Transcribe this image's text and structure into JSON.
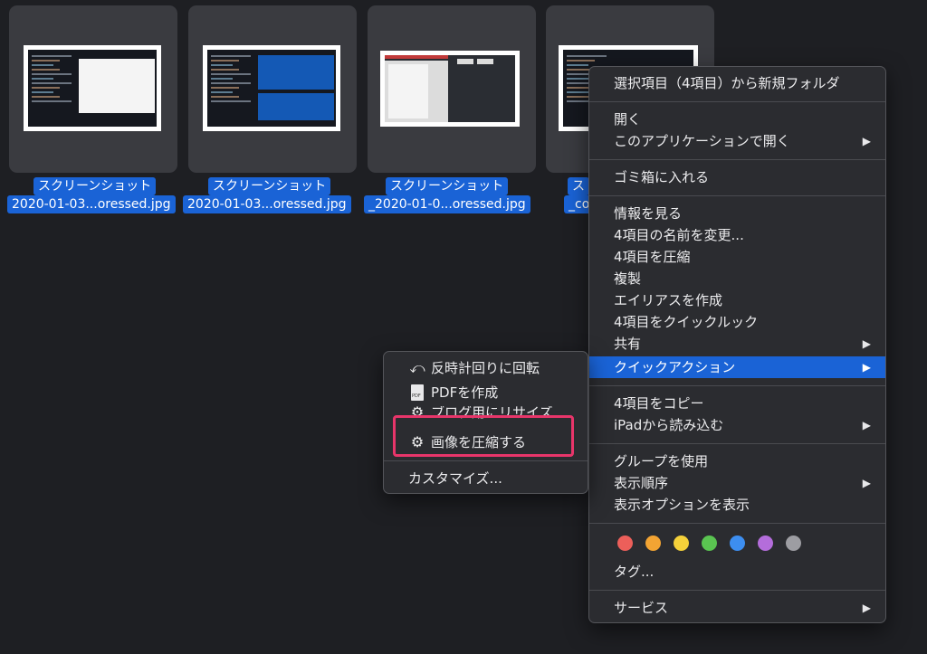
{
  "files": [
    {
      "label_line1": "スクリーンショット",
      "label_line2": "2020-01-03...oressed.jpg"
    },
    {
      "label_line1": "スクリーンショット",
      "label_line2": "2020-01-03...oressed.jpg"
    },
    {
      "label_line1": "スクリーンショット",
      "label_line2": "_2020-01-0...oressed.jpg"
    },
    {
      "label_line1": "ス",
      "label_line2": "_co"
    }
  ],
  "context_menu": {
    "new_folder": "選択項目（4項目）から新規フォルダ",
    "open": "開く",
    "open_with": "このアプリケーションで開く",
    "trash": "ゴミ箱に入れる",
    "get_info": "情報を見る",
    "rename": "4項目の名前を変更...",
    "compress": "4項目を圧縮",
    "duplicate": "複製",
    "make_alias": "エイリアスを作成",
    "quick_look": "4項目をクイックルック",
    "share": "共有",
    "quick_actions": "クイックアクション",
    "copy": "4項目をコピー",
    "import_ipad": "iPadから読み込む",
    "use_groups": "グループを使用",
    "sort_by": "表示順序",
    "show_view_options": "表示オプションを表示",
    "tags": "タグ...",
    "services": "サービス",
    "submenu_arrow": "▶"
  },
  "tag_colors": [
    "#ec5f5a",
    "#f3a433",
    "#f5d13a",
    "#5ac451",
    "#3d8ef0",
    "#b46ddb",
    "#9d9da2"
  ],
  "quick_actions_menu": {
    "rotate_left": "反時計回りに回転",
    "create_pdf": "PDFを作成",
    "resize_for_blog": "ブログ用にリサイズ",
    "compress_image": "画像を圧縮する",
    "customize": "カスタマイズ...",
    "pdf_icon_text": "PDF",
    "rotate_icon": "⤺",
    "gear_icon": "⚙"
  },
  "colors": {
    "accent": "#1a63d6",
    "highlight_frame": "#e8356a",
    "menu_bg": "#2b2c30",
    "desktop_bg": "#1e1f23"
  }
}
